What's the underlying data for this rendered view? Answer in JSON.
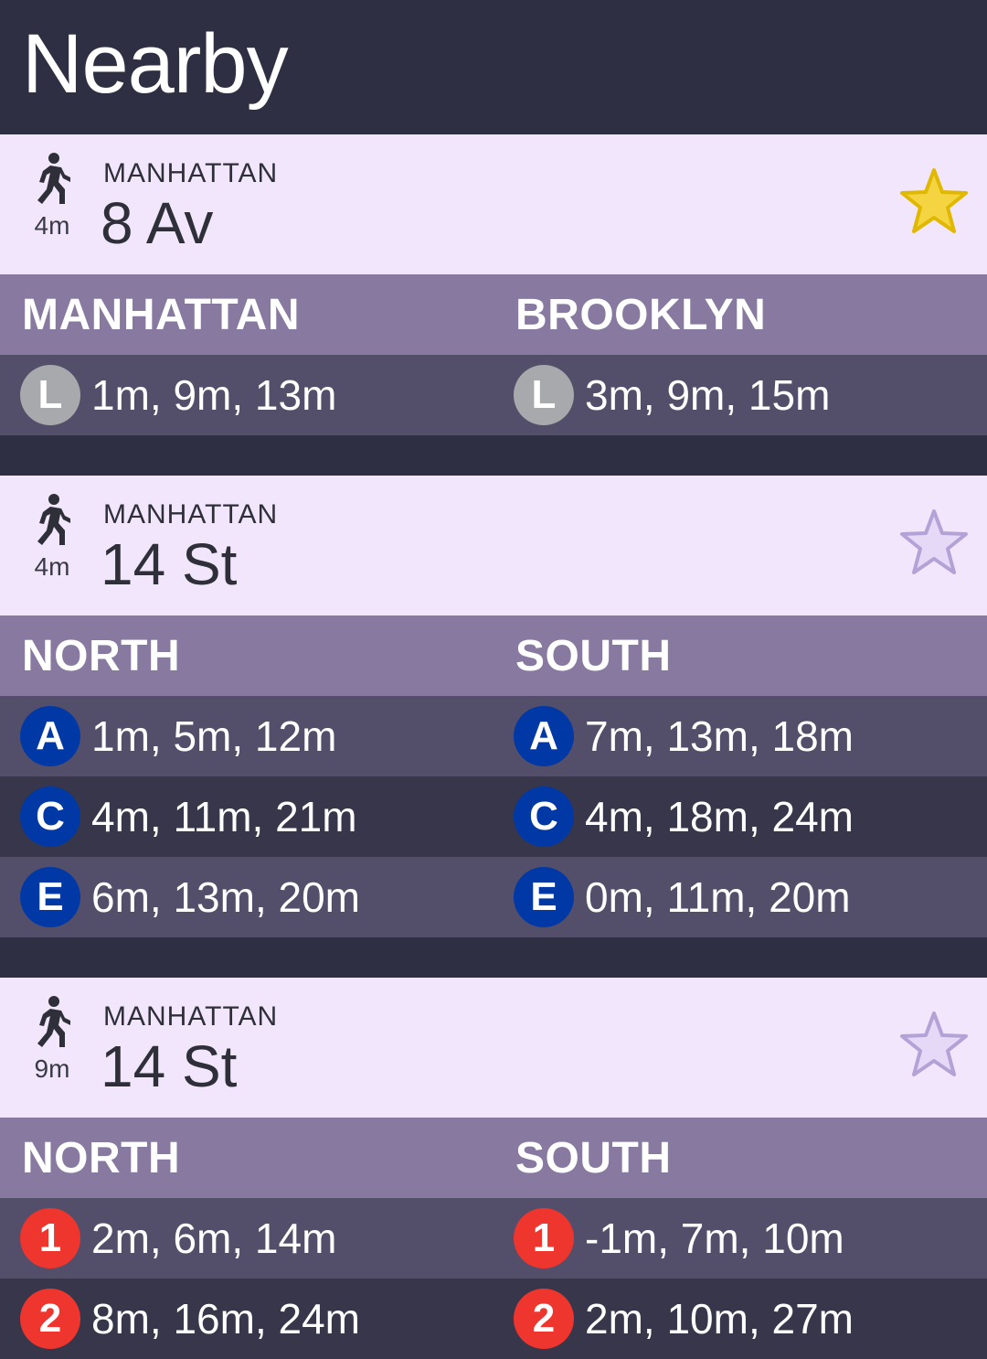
{
  "app": {
    "title": "Nearby"
  },
  "colors": {
    "header_bg": "#2e2f42",
    "station_bg": "#f1e6fc",
    "direction_bg": "#87799f",
    "row_light": "#534e6a",
    "row_dark": "#37364b",
    "star_active": "#f5d442",
    "star_inactive": "#cdbbe8",
    "line_L": "#a7a9ac",
    "line_ACE": "#0039a6",
    "line_123": "#ee352e"
  },
  "stations": [
    {
      "walk_time": "4m",
      "borough": "MANHATTAN",
      "name": "8 Av",
      "favorite": true,
      "star_icon": "star-filled-icon",
      "directions": [
        "MANHATTAN",
        "BROOKLYN"
      ],
      "rows": [
        {
          "left": {
            "line": "L",
            "color": "#a7a9ac",
            "times": "1m, 9m, 13m"
          },
          "right": {
            "line": "L",
            "color": "#a7a9ac",
            "times": "3m, 9m, 15m"
          }
        }
      ]
    },
    {
      "walk_time": "4m",
      "borough": "MANHATTAN",
      "name": "14 St",
      "favorite": false,
      "star_icon": "star-outline-icon",
      "directions": [
        "NORTH",
        "SOUTH"
      ],
      "rows": [
        {
          "left": {
            "line": "A",
            "color": "#0039a6",
            "times": "1m, 5m, 12m"
          },
          "right": {
            "line": "A",
            "color": "#0039a6",
            "times": "7m, 13m, 18m"
          }
        },
        {
          "left": {
            "line": "C",
            "color": "#0039a6",
            "times": "4m, 11m, 21m"
          },
          "right": {
            "line": "C",
            "color": "#0039a6",
            "times": "4m, 18m, 24m"
          }
        },
        {
          "left": {
            "line": "E",
            "color": "#0039a6",
            "times": "6m, 13m, 20m"
          },
          "right": {
            "line": "E",
            "color": "#0039a6",
            "times": "0m, 11m, 20m"
          }
        }
      ]
    },
    {
      "walk_time": "9m",
      "borough": "MANHATTAN",
      "name": "14 St",
      "favorite": false,
      "star_icon": "star-outline-icon",
      "directions": [
        "NORTH",
        "SOUTH"
      ],
      "rows": [
        {
          "left": {
            "line": "1",
            "color": "#ee352e",
            "times": "2m, 6m, 14m"
          },
          "right": {
            "line": "1",
            "color": "#ee352e",
            "times": "-1m, 7m, 10m"
          }
        },
        {
          "left": {
            "line": "2",
            "color": "#ee352e",
            "times": "8m, 16m, 24m"
          },
          "right": {
            "line": "2",
            "color": "#ee352e",
            "times": "2m, 10m, 27m"
          }
        }
      ]
    }
  ]
}
